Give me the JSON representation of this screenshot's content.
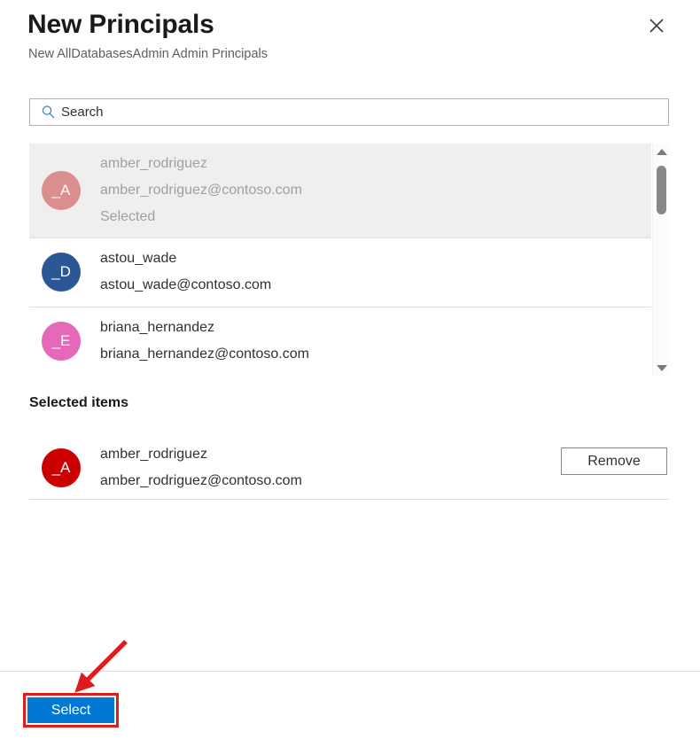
{
  "header": {
    "title": "New Principals",
    "subtitle": "New AllDatabasesAdmin Admin Principals",
    "close_icon": "close-icon"
  },
  "search": {
    "placeholder": "Search",
    "value": "",
    "icon": "search-icon"
  },
  "people_list": {
    "items": [
      {
        "initials": "_A",
        "name": "amber_rodriguez",
        "email": "amber_rodriguez@contoso.com",
        "status": "Selected",
        "avatar_color": "#d46a6a",
        "selected": true
      },
      {
        "initials": "_D",
        "name": "astou_wade",
        "email": "astou_wade@contoso.com",
        "status": "",
        "avatar_color": "#2b5797",
        "selected": false
      },
      {
        "initials": "_E",
        "name": "briana_hernandez",
        "email": "briana_hernandez@contoso.com",
        "status": "",
        "avatar_color": "#e569b8",
        "selected": false
      }
    ],
    "scrollbar": {
      "up_arrow_icon": "chevron-up-icon",
      "down_arrow_icon": "chevron-down-icon"
    }
  },
  "selected_items": {
    "heading": "Selected items",
    "rows": [
      {
        "initials": "_A",
        "name": "amber_rodriguez",
        "email": "amber_rodriguez@contoso.com",
        "avatar_color": "#cc0000",
        "remove_label": "Remove"
      }
    ]
  },
  "footer": {
    "select_label": "Select"
  },
  "annotations": {
    "highlight_color": "#e01b1b",
    "arrow_color": "#e01b1b",
    "target": "select-button"
  },
  "colors": {
    "accent": "#0078d4",
    "text_primary": "#323130",
    "text_secondary": "#605e5c",
    "text_disabled": "#a19f9d",
    "divider": "#e1dfdd",
    "selected_row_bg": "#f0efee"
  }
}
